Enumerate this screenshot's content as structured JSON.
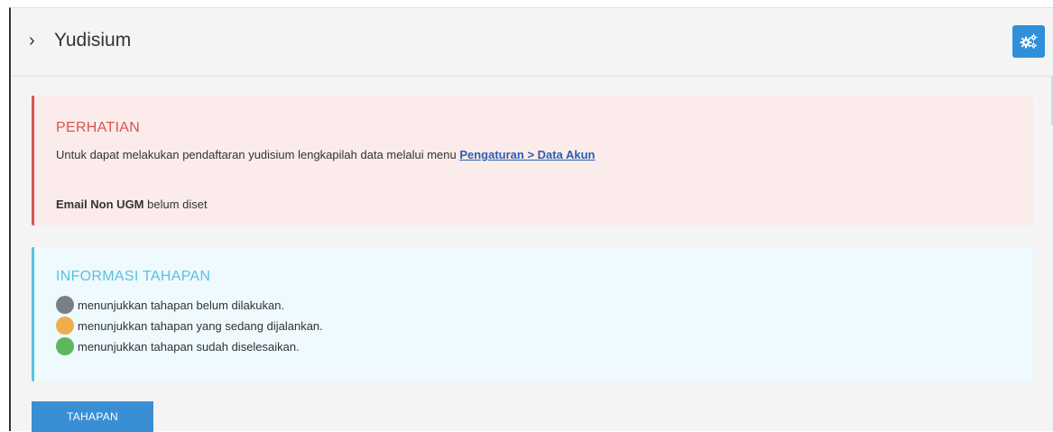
{
  "header": {
    "title": "Yudisium",
    "chevron": "›",
    "settings_icon": "gears-icon"
  },
  "warning": {
    "title": "PERHATIAN",
    "message": "Untuk dapat melakukan pendaftaran yudisium lengkapilah data melalui menu ",
    "link": "Pengaturan > Data Akun",
    "email_label": "Email Non UGM",
    "email_status": " belum diset"
  },
  "info": {
    "title": "INFORMASI TAHAPAN",
    "legend": [
      {
        "color": "#7a7f85",
        "text": "menunjukkan tahapan belum dilakukan."
      },
      {
        "color": "#f0ad4e",
        "text": "menunjukkan tahapan yang sedang dijalankan."
      },
      {
        "color": "#5cb85c",
        "text": "menunjukkan tahapan sudah diselesaikan."
      }
    ]
  },
  "actions": {
    "tahapan_label": "TAHAPAN"
  },
  "colors": {
    "primary": "#3a8fd4",
    "danger": "#d9534f",
    "info": "#5bc0de"
  }
}
